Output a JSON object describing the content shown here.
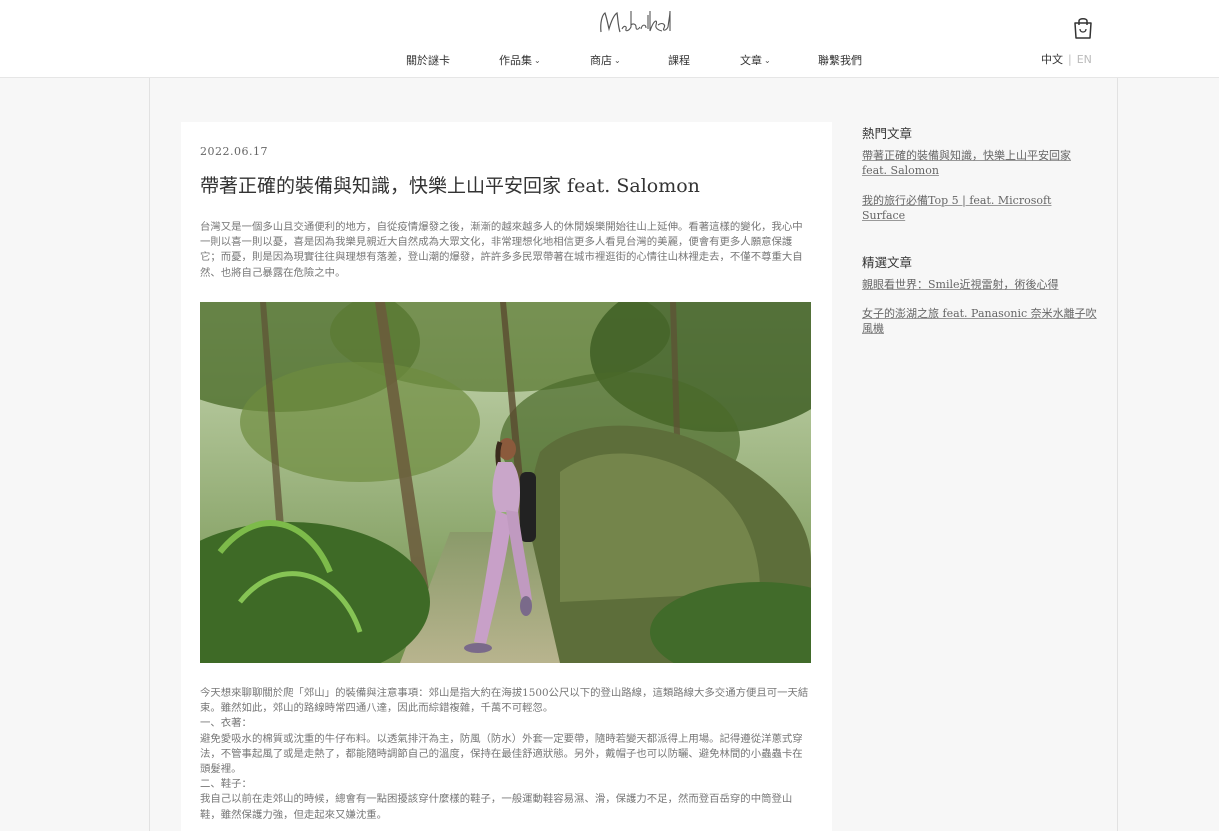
{
  "header": {
    "logo_text": "MeetTheRoad",
    "nav": [
      {
        "label": "關於謎卡",
        "has_menu": false
      },
      {
        "label": "作品集",
        "has_menu": true
      },
      {
        "label": "商店",
        "has_menu": true
      },
      {
        "label": "課程",
        "has_menu": false
      },
      {
        "label": "文章",
        "has_menu": true
      },
      {
        "label": "聯繫我們",
        "has_menu": false
      }
    ],
    "lang": {
      "zh": "中文",
      "separator": "|",
      "en": "EN"
    },
    "cart_icon": "shopping-bag-icon"
  },
  "article": {
    "date": "2022.06.17",
    "title": "帶著正確的裝備與知識，快樂上山平安回家 feat. Salomon",
    "intro": "台灣又是一個多山且交通便利的地方，自從疫情爆發之後，漸漸的越來越多人的休閒娛樂開始往山上延伸。看著這樣的變化，我心中一則以喜一則以憂，喜是因為我樂見親近大自然成為大眾文化，非常理想化地相信更多人看見台灣的美麗，便會有更多人願意保護它；而憂，則是因為現實往往與理想有落差，登山潮的爆發，許許多多民眾帶著在城市裡逛街的心情往山林裡走去，不僅不尊重大自然、也將自己暴露在危險之中。",
    "image_alt": "hiker-photo",
    "paragraphs": [
      "今天想來聊聊關於爬「郊山」的裝備與注意事項：郊山是指大約在海拔1500公尺以下的登山路線，這類路線大多交通方便且可一天結束。雖然如此，郊山的路線時常四通八達，因此而綜錯複雜，千萬不可輕忽。",
      "一、衣著：",
      "避免愛吸水的棉質或沈重的牛仔布料。以透氣排汗為主，防風（防水）外套一定要帶，隨時若變天都派得上用場。記得遵從洋蔥式穿法，不管事起風了或是走熱了，都能隨時調節自己的溫度，保持在最佳舒適狀態。另外，戴帽子也可以防曬、避免林間的小蟲蟲卡在頭髮裡。",
      "二、鞋子：",
      "我自己以前在走郊山的時候，總會有一點困擾該穿什麼樣的鞋子，一般運動鞋容易濕、滑，保護力不足，然而登百岳穿的中筒登山鞋，雖然保護力強，但走起來又嫌沈重。"
    ]
  },
  "sidebar": {
    "popular_title": "熱門文章",
    "popular": [
      "帶著正確的裝備與知識，快樂上山平安回家 feat. Salomon",
      "我的旅行必備Top 5 | feat. Microsoft Surface"
    ],
    "featured_title": "精選文章",
    "featured": [
      "親眼看世界：Smile近視雷射，術後心得",
      "女子的澎湖之旅 feat. Panasonic 奈米水離子吹風機"
    ]
  }
}
